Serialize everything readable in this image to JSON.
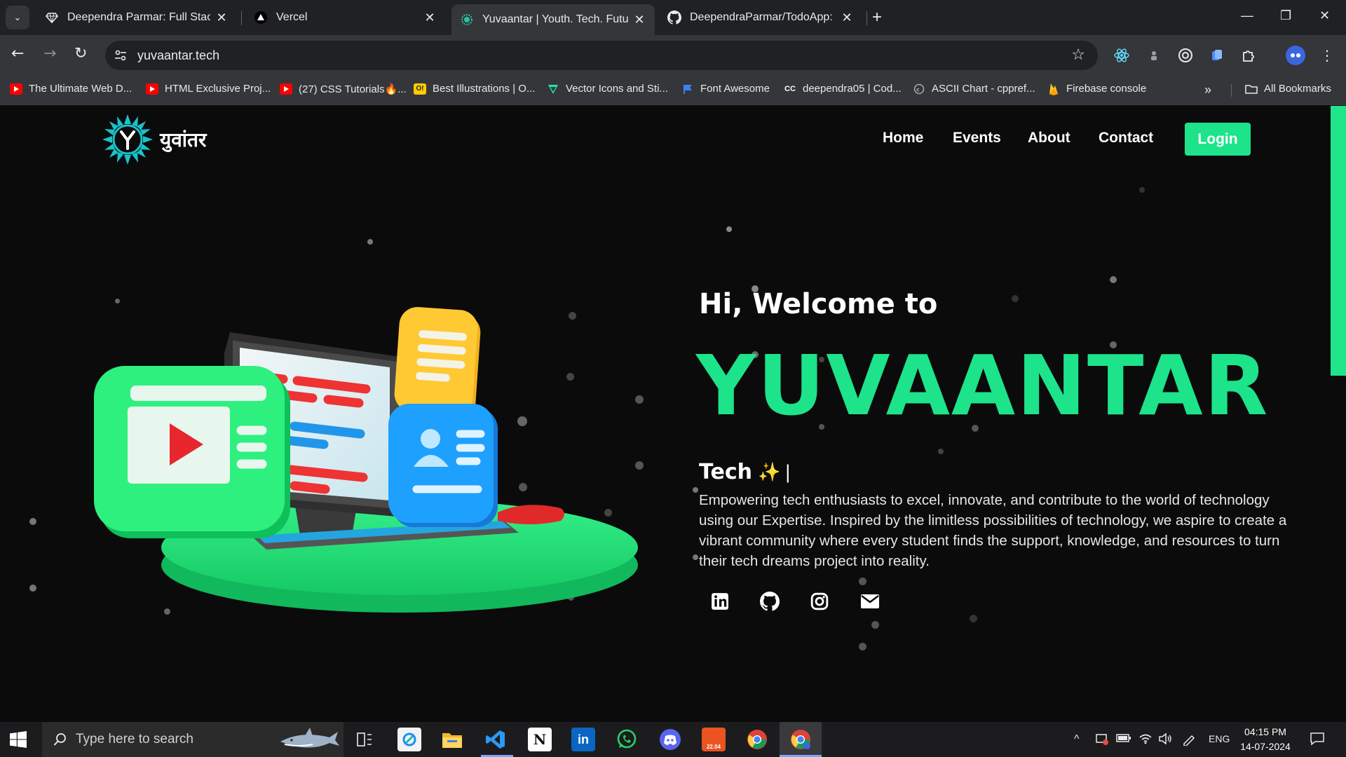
{
  "tabs": [
    {
      "title": "Deependra Parmar: Full Stack E",
      "favicon": "diamond-icon",
      "active": false
    },
    {
      "title": "Vercel",
      "favicon": "vercel-triangle-icon",
      "active": false
    },
    {
      "title": "Yuvaantar | Youth. Tech. Future.",
      "favicon": "yuvaantar-icon",
      "active": true
    },
    {
      "title": "DeependraParmar/TodoApp: Th",
      "favicon": "github-icon",
      "active": false
    }
  ],
  "address_bar": {
    "url": "yuvaantar.tech"
  },
  "bookmarks": {
    "items": [
      {
        "label": "The Ultimate Web D...",
        "icon": "youtube-icon",
        "color": "#ff0000"
      },
      {
        "label": "HTML Exclusive Proj...",
        "icon": "youtube-icon",
        "color": "#ff0000"
      },
      {
        "label": "(27) CSS Tutorials🔥...",
        "icon": "youtube-icon",
        "color": "#ff0000"
      },
      {
        "label": "Best Illustrations | O...",
        "icon": "ouch-icon",
        "color": "#ffcc00"
      },
      {
        "label": "Vector Icons and Sti...",
        "icon": "flaticon-icon",
        "color": "#1de9b6"
      },
      {
        "label": "Font Awesome",
        "icon": "flag-icon",
        "color": "#3b82f6"
      },
      {
        "label": "deependra05 | Cod...",
        "icon": "codechef-icon",
        "color": "#ffffff"
      },
      {
        "label": "ASCII Chart - cppref...",
        "icon": "cppref-icon",
        "color": "#aaaaaa"
      },
      {
        "label": "Firebase console",
        "icon": "firebase-icon",
        "color": "#ffca28"
      }
    ],
    "all_bookmarks_label": "All Bookmarks"
  },
  "site": {
    "logo_text": "युवांतर",
    "nav": [
      "Home",
      "Events",
      "About",
      "Contact"
    ],
    "login_label": "Login",
    "greeting": "Hi, Welcome to",
    "brand": "YUVAANTAR",
    "typed_word": "Tech",
    "typed_caret": "|",
    "description": "Empowering tech enthusiasts to excel, innovate, and contribute to the world of technology using our Expertise. Inspired by the limitless possibilities of technology, we aspire to create a vibrant community where every student finds the support, knowledge, and resources to turn their tech dreams project into reality.",
    "social": [
      "linkedin-icon",
      "github-icon",
      "instagram-icon",
      "mail-icon"
    ],
    "accent_color": "#1de38a"
  },
  "taskbar": {
    "search_placeholder": "Type here to search",
    "apps": [
      "task-view-icon",
      "snipping-icon",
      "file-explorer-icon",
      "vscode-icon",
      "notion-icon",
      "linkedin-icon",
      "whatsapp-icon",
      "discord-icon",
      "ubuntu-icon",
      "chrome-icon",
      "chrome-profile-icon"
    ],
    "language": "ENG",
    "time": "04:15 PM",
    "date": "14-07-2024"
  }
}
